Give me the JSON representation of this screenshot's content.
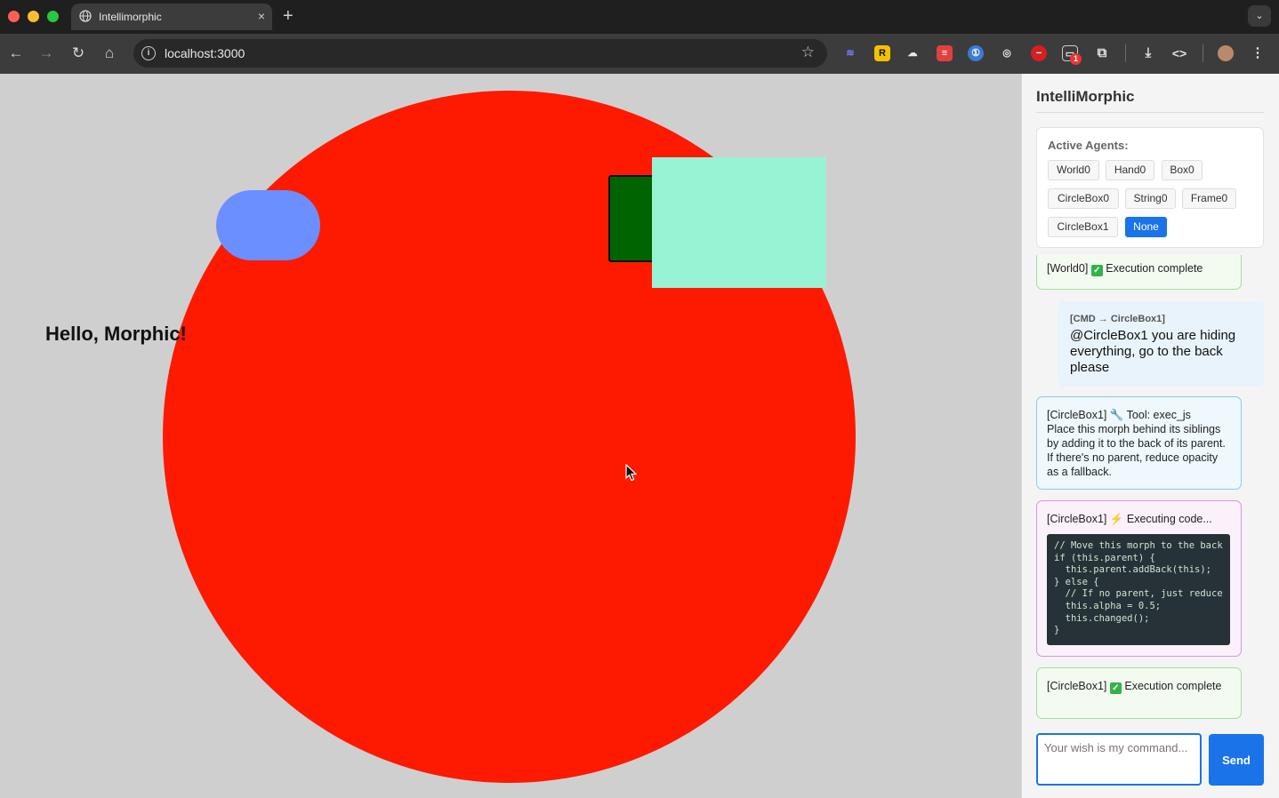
{
  "browser": {
    "tab_title": "Intellimorphic",
    "tab_close": "×",
    "new_tab": "+",
    "tab_menu": "⌄",
    "url": "localhost:3000",
    "extension_badge": "1"
  },
  "world": {
    "hello_text": "Hello, Morphic!",
    "colors": {
      "circle": "#fd1a00",
      "pill": "#6b8fff",
      "green_box": "#006400",
      "mint_box": "#97f3d3",
      "background": "#cfcfcf"
    }
  },
  "panel": {
    "title": "IntelliMorphic",
    "agents_label": "Active Agents:",
    "agents": [
      "World0",
      "Hand0",
      "Box0",
      "CircleBox0",
      "String0",
      "Frame0",
      "CircleBox1",
      "None"
    ],
    "selected_agent": "None",
    "messages": {
      "m1": "[World0]",
      "m1_status": "Execution complete",
      "cmd_head": "[CMD → CircleBox1]",
      "cmd_text": "@CircleBox1 you are hiding everything, go to the back please",
      "m3_head": "[CircleBox1] 🔧 Tool: exec_js",
      "m3_body": "Place this morph behind its siblings by adding it to the back of its parent. If there's no parent, reduce opacity as a fallback.",
      "m4_head": "[CircleBox1] ⚡ Executing code...",
      "m4_code": "// Move this morph to the back\nif (this.parent) {\n  this.parent.addBack(this);\n} else {\n  // If no parent, just reduce\n  this.alpha = 0.5;\n  this.changed();\n}",
      "m5": "[CircleBox1]",
      "m5_status": "Execution complete"
    },
    "input_placeholder": "Your wish is my command...",
    "send_label": "Send",
    "accent": "#1a73e8"
  }
}
